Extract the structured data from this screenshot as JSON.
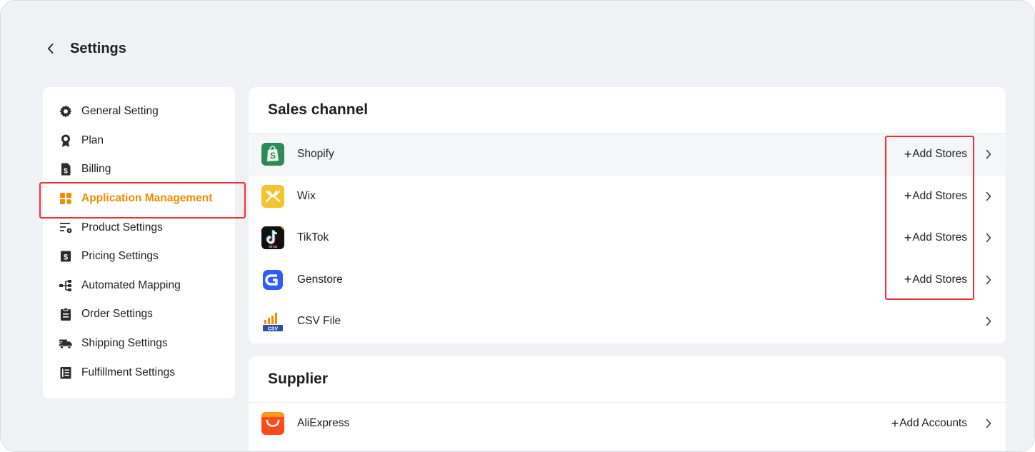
{
  "header": {
    "title": "Settings"
  },
  "sidebar": {
    "items": [
      {
        "label": "General Setting",
        "icon": "gear-icon"
      },
      {
        "label": "Plan",
        "icon": "award-icon"
      },
      {
        "label": "Billing",
        "icon": "billing-icon"
      },
      {
        "label": "Application Management",
        "icon": "grid-icon",
        "active": true
      },
      {
        "label": "Product Settings",
        "icon": "product-settings-icon"
      },
      {
        "label": "Pricing Settings",
        "icon": "dollar-icon"
      },
      {
        "label": "Automated Mapping",
        "icon": "mapping-icon"
      },
      {
        "label": "Order Settings",
        "icon": "clipboard-icon"
      },
      {
        "label": "Shipping Settings",
        "icon": "truck-icon"
      },
      {
        "label": "Fulfillment Settings",
        "icon": "list-icon"
      }
    ]
  },
  "sales_channel": {
    "title": "Sales channel",
    "rows": [
      {
        "name": "Shopify",
        "action": "Add Stores",
        "icon": "shopify-icon"
      },
      {
        "name": "Wix",
        "action": "Add Stores",
        "icon": "wix-icon"
      },
      {
        "name": "TikTok",
        "action": "Add Stores",
        "icon": "tiktok-icon",
        "logo_text": "TikTok"
      },
      {
        "name": "Genstore",
        "action": "Add Stores",
        "icon": "genstore-icon"
      },
      {
        "name": "CSV File",
        "action": "",
        "icon": "csv-icon",
        "logo_text": "CSV"
      }
    ]
  },
  "supplier": {
    "title": "Supplier",
    "rows": [
      {
        "name": "AliExpress",
        "action": "Add Accounts",
        "icon": "aliexpress-icon"
      }
    ]
  },
  "colors": {
    "accent": "#f08c00",
    "highlight": "#e8303a",
    "background": "#f0f1f5"
  }
}
